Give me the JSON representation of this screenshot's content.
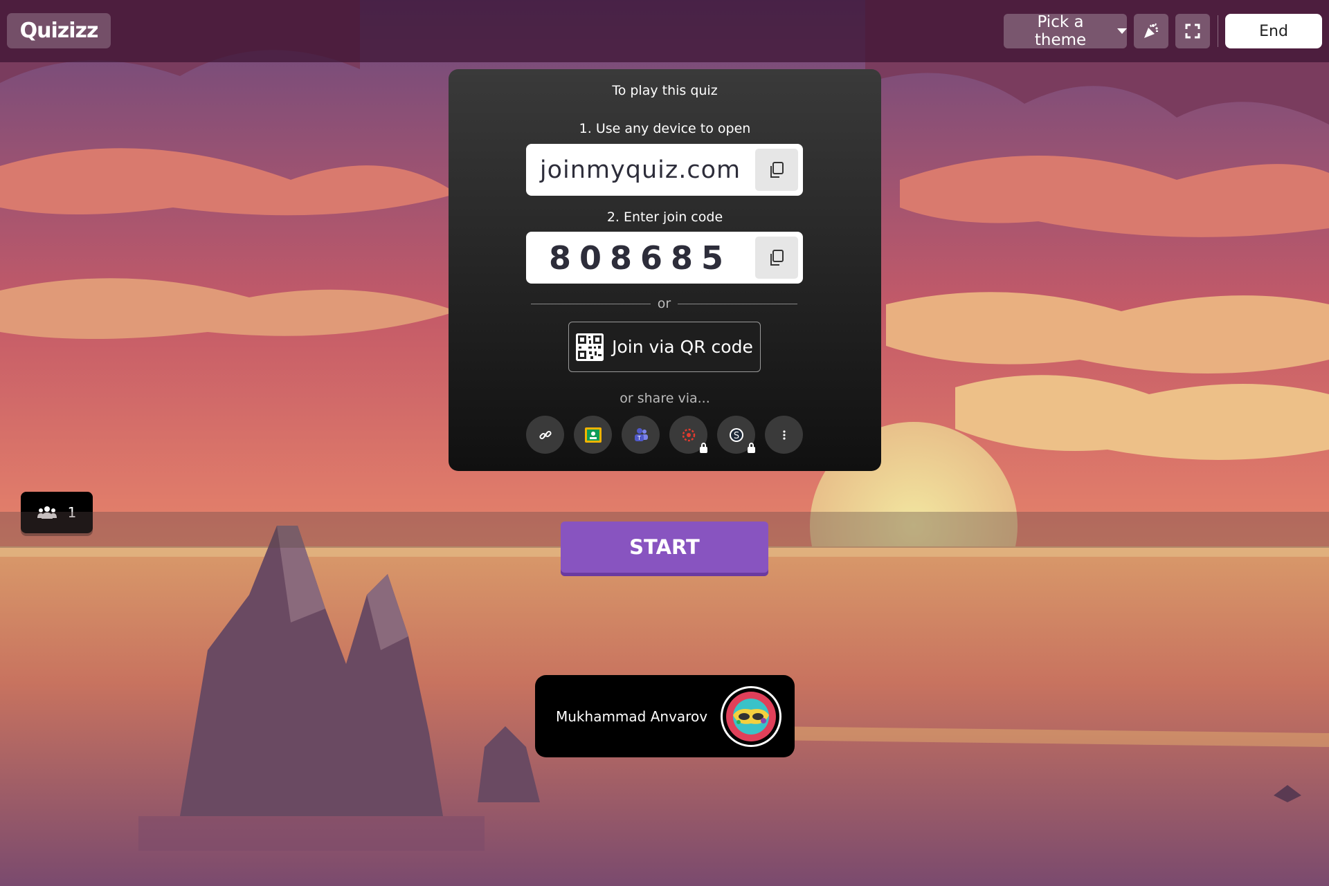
{
  "header": {
    "logo": "Quizizz",
    "theme_label": "Pick a theme",
    "end_label": "End"
  },
  "join_card": {
    "title": "To play this quiz",
    "step1": "1. Use any device to open",
    "url": "joinmyquiz.com",
    "step2": "2. Enter join code",
    "code": "808685",
    "or_label": "or",
    "qr_label": "Join via QR code",
    "share_label": "or share via...",
    "share_icons": [
      "link-icon",
      "google-classroom-icon",
      "teams-icon",
      "canvas-icon",
      "schoology-icon",
      "more-icon"
    ]
  },
  "players": {
    "count": "1"
  },
  "start_label": "START",
  "player": {
    "name": "Mukhammad Anvarov"
  },
  "colors": {
    "accent": "#8854c0",
    "card": "#1a1a1a",
    "header": "#3c1432"
  }
}
